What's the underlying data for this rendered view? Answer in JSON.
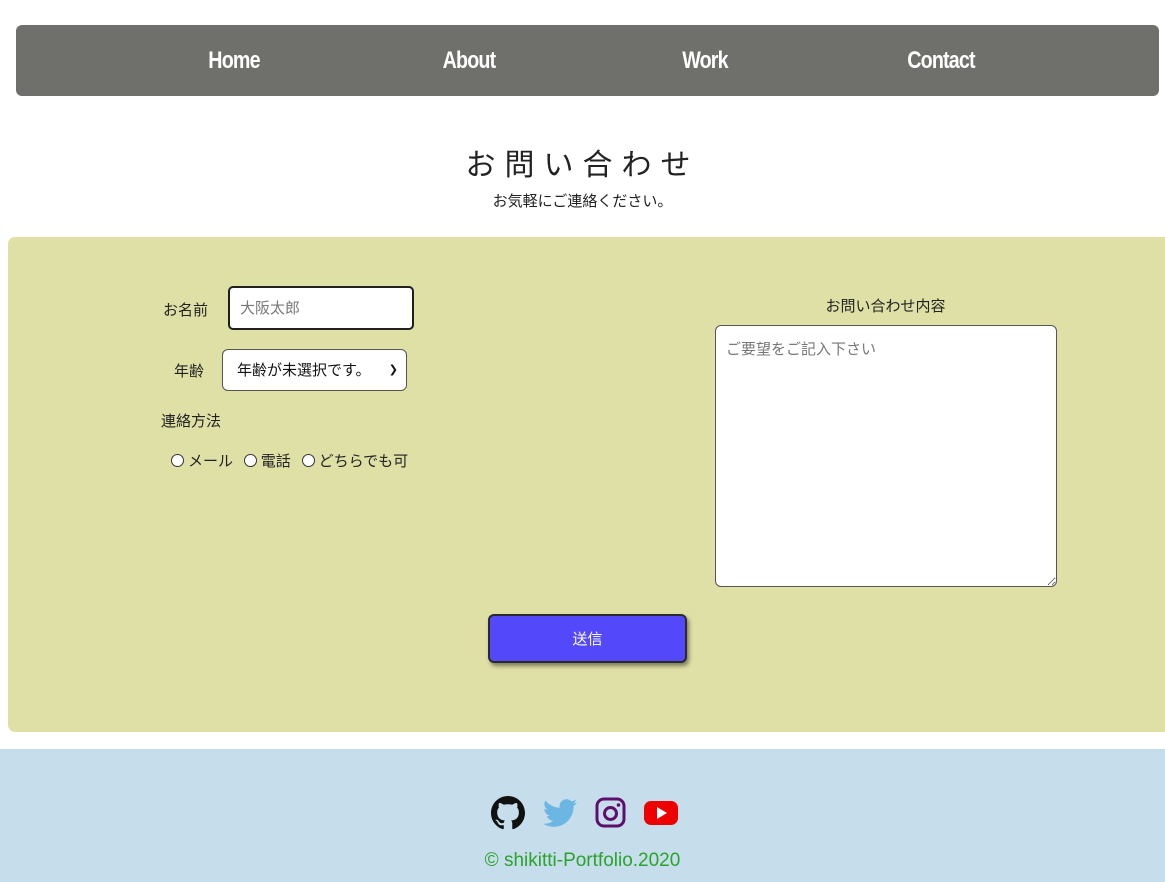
{
  "nav": {
    "items": [
      {
        "label": "Home"
      },
      {
        "label": "About"
      },
      {
        "label": "Work"
      },
      {
        "label": "Contact"
      }
    ]
  },
  "header": {
    "title": "お問い合わせ",
    "subtitle": "お気軽にご連絡ください。"
  },
  "form": {
    "name_label": "お名前",
    "name_placeholder": "大阪太郎",
    "age_label": "年齢",
    "age_selected": "年齢が未選択です。",
    "contact_method_label": "連絡方法",
    "contact_options": [
      {
        "label": "メール"
      },
      {
        "label": "電話"
      },
      {
        "label": "どちらでも可"
      }
    ],
    "message_label": "お問い合わせ内容",
    "message_placeholder": "ご要望をご記入下さい",
    "submit_label": "送信"
  },
  "footer": {
    "icons": [
      "github-icon",
      "twitter-icon",
      "instagram-icon",
      "youtube-icon"
    ],
    "copyright": "© shikitti-Portfolio.2020"
  },
  "colors": {
    "nav_bg": "#6f6f6b",
    "form_bg": "#dfe0a6",
    "submit_bg": "#5349fb",
    "footer_bg": "#c6deec",
    "copyright_text": "#2ba32b",
    "github": "#111111",
    "twitter": "#6cb6e4",
    "instagram": "#5e0f6b",
    "youtube": "#ee0000"
  }
}
